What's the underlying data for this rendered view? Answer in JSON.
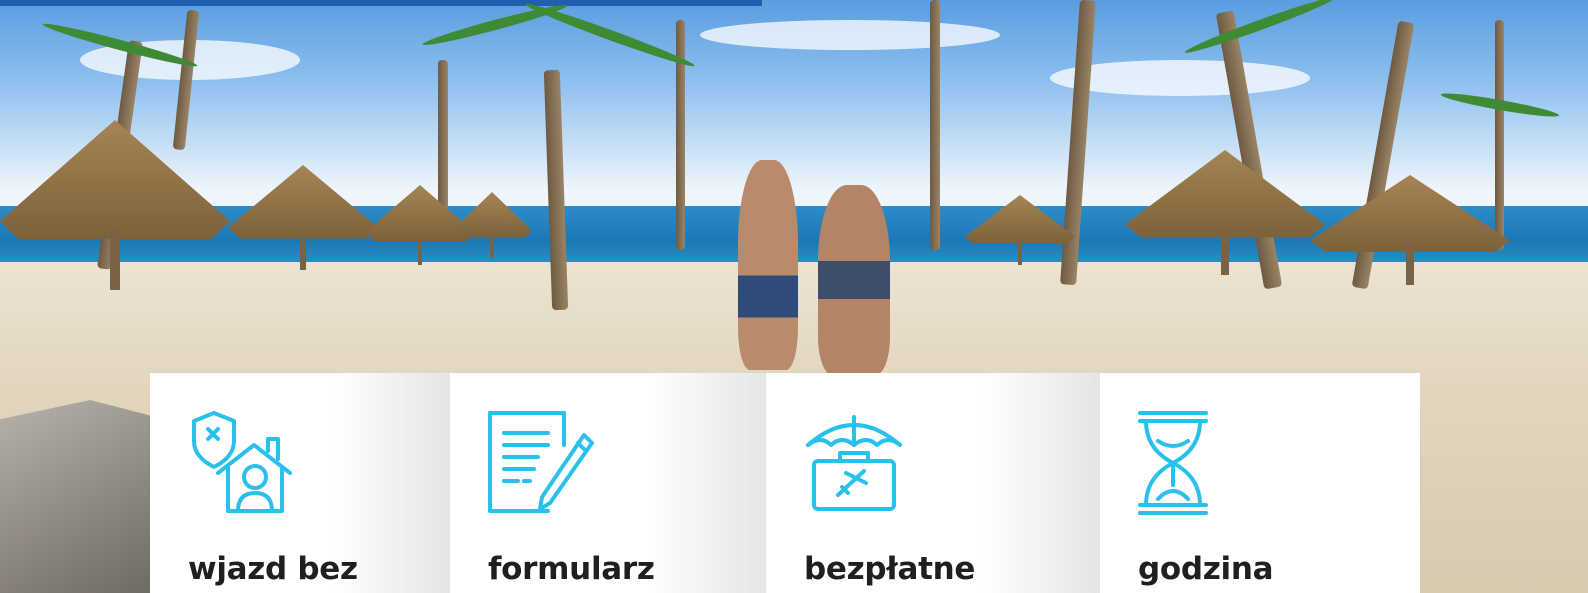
{
  "hero": {
    "scene": "beach-with-palm-huts-photo"
  },
  "colors": {
    "icon_stroke": "#29c1ec",
    "title_text": "#1f1f1f",
    "top_bar": "#1f5fae",
    "card_background": "#ffffff"
  },
  "features": [
    {
      "title": "wjazd bez",
      "icon": "shield-house-person-icon"
    },
    {
      "title": "formularz",
      "icon": "document-pencil-icon"
    },
    {
      "title": "bezpłatne",
      "icon": "umbrella-suitcase-plane-icon"
    },
    {
      "title": "godzina",
      "icon": "hourglass-icon"
    }
  ]
}
